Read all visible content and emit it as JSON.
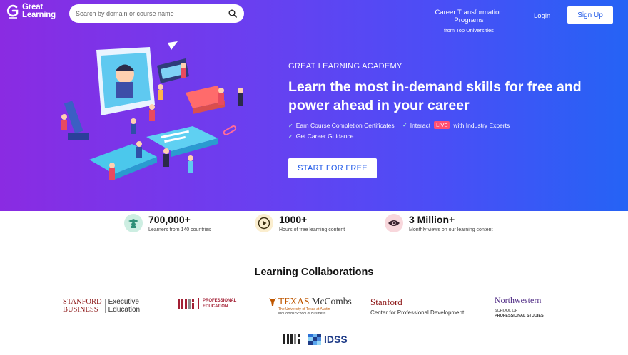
{
  "header": {
    "logo_line1": "Great",
    "logo_line2": "Learning",
    "search_placeholder": "Search by domain or course name",
    "career_line1": "Career Transformation Programs",
    "career_line2": "from Top Universities",
    "login_label": "Login",
    "signup_label": "Sign Up"
  },
  "hero": {
    "eyebrow": "GREAT LEARNING ACADEMY",
    "headline": "Learn the most in-demand skills for free and power ahead in your career",
    "features": {
      "f1": "Earn Course Completion Certificates",
      "f2_prefix": "Interact",
      "f2_badge": "LIVE",
      "f2_suffix": "with Industry Experts",
      "f3": "Get Career Guidance"
    },
    "cta_label": "START FOR FREE"
  },
  "stats": [
    {
      "value": "700,000+",
      "caption": "Learners from 140 countries",
      "icon": "graduate-icon",
      "color": "#cdeee2"
    },
    {
      "value": "1000+",
      "caption": "Hours of free learning content",
      "icon": "play-icon",
      "color": "#fbeecf"
    },
    {
      "value": "3 Million+",
      "caption": "Monthly views on our learning content",
      "icon": "eye-icon",
      "color": "#f8d7dc"
    }
  ],
  "collab": {
    "title": "Learning Collaborations",
    "stanford_gsb_1": "STANFORD",
    "stanford_gsb_2": "BUSINESS",
    "stanford_gsb_3": "Executive",
    "stanford_gsb_4": "Education",
    "mit_pe_1": "PROFESSIONAL",
    "mit_pe_2": "EDUCATION",
    "texas_1": "TEXAS",
    "texas_2": "McCombs",
    "texas_3": "The University of Texas at Austin",
    "texas_4": "McCombs School of Business",
    "stanford_cpd_1": "Stanford",
    "stanford_cpd_2": "Center for Professional Development",
    "nw_1": "Northwestern",
    "nw_2": "SCHOOL OF",
    "nw_3": "PROFESSIONAL STUDIES",
    "idss": "IDSS"
  },
  "colors": {
    "brand_blue": "#1a55e8",
    "hero_start": "#8a2be2",
    "hero_end": "#2563f5",
    "live_badge": "#ff4f73"
  }
}
